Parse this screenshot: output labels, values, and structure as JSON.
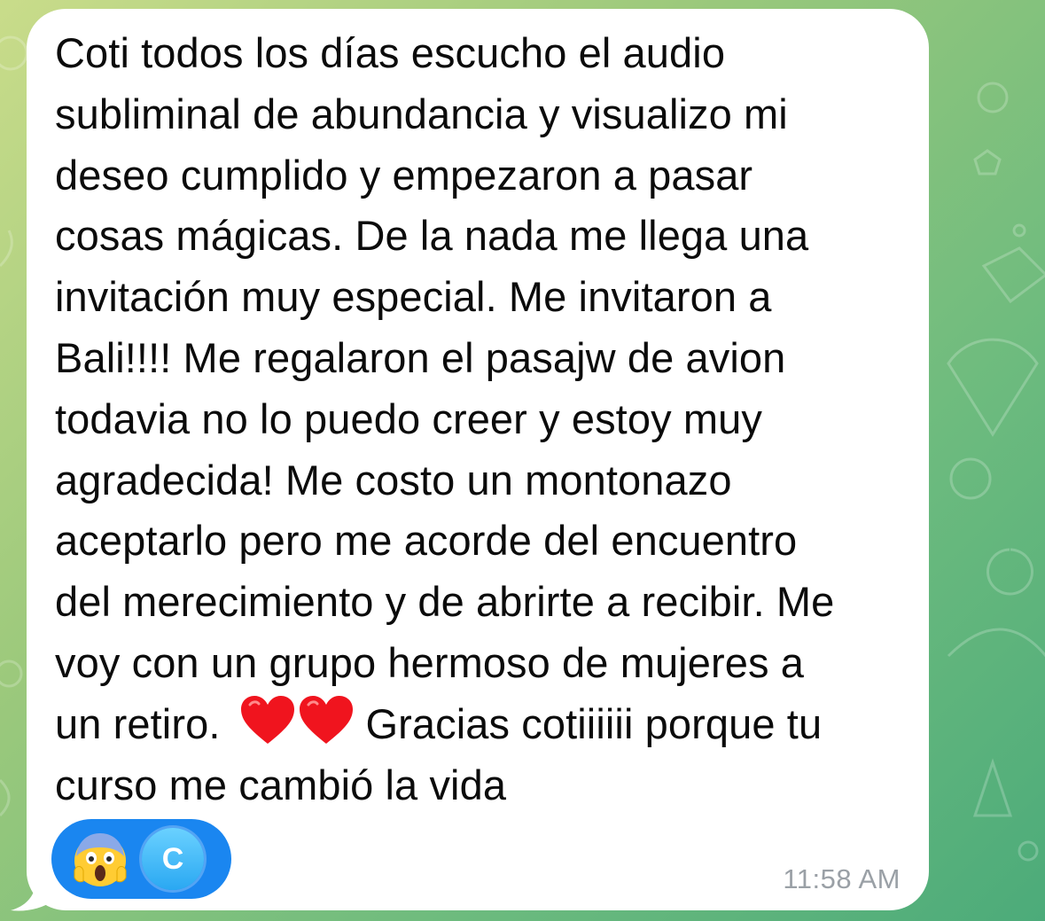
{
  "chat": {
    "message": {
      "lines": [
        "Coti todos los días escucho el audio",
        "subliminal de abundancia y visualizo mi",
        "deseo cumplido y empezaron a pasar",
        "cosas mágicas. De la nada me llega una"
      ],
      "line5_plain": "invitación muy especial. ",
      "line5_highlight": "Me invitaron a",
      "line6_highlight": "Bali!!!! Me regalaron el pasajw de avion",
      "line7": "todavia no lo puedo creer y estoy muy",
      "line8": "agradecida! Me costo un montonazo",
      "line9_plain": "aceptarlo pero ",
      "line9_highlight": "me acorde del encuentro",
      "line10_highlight": "del merecimiento y de abrirte a recibir",
      "line10_plain": ". Me",
      "line11": "voy con un grupo hermoso de mujeres a",
      "line12_plain": "un retiro.",
      "line12_after": "Gracias cotiiiiii porque tu",
      "line13": "curso me cambió la vida",
      "inline_icons": [
        "red-heart-icon",
        "red-heart-icon"
      ],
      "highlight_color": "#b5d98b"
    },
    "reactions": {
      "emoji": "face-screaming-in-fear-icon",
      "avatar_letter": "C",
      "pill_color": "#1a86f0"
    },
    "timestamp": "11:58 AM"
  }
}
